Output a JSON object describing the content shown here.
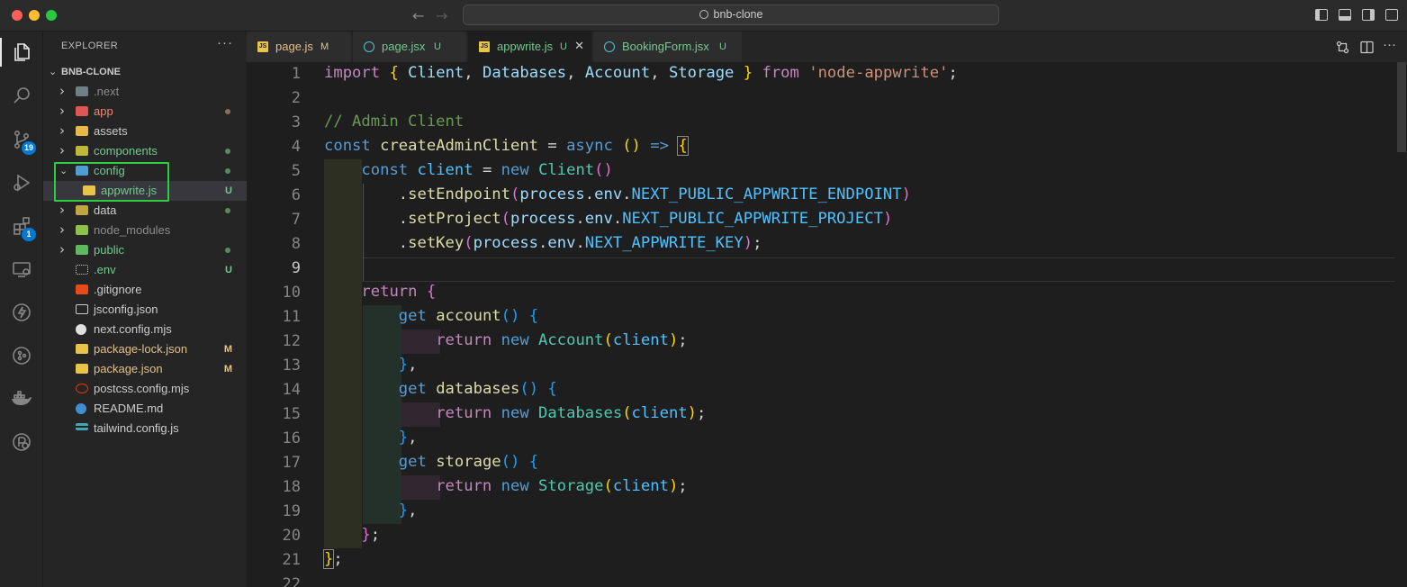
{
  "window": {
    "search_text": "bnb-clone",
    "colors": {
      "close": "#ff5f57",
      "minimize": "#febc2e",
      "maximize": "#28c840"
    }
  },
  "activity_bar": {
    "icons": [
      "explorer-icon",
      "search-icon",
      "source-control-icon",
      "run-debug-icon",
      "extensions-icon",
      "remote-explorer-icon",
      "lightning-icon",
      "git-graph-icon",
      "docker-icon",
      "accounts-icon"
    ],
    "source_control_badge": "19",
    "extensions_badge": "1"
  },
  "explorer": {
    "header": "EXPLORER",
    "more": "···",
    "project": "BNB-CLONE",
    "items": [
      {
        "label": ".next",
        "kind": "folder",
        "status": ""
      },
      {
        "label": "app",
        "kind": "folder",
        "status": "dot"
      },
      {
        "label": "assets",
        "kind": "folder",
        "status": ""
      },
      {
        "label": "components",
        "kind": "folder",
        "status": "dot"
      },
      {
        "label": "config",
        "kind": "folder-open",
        "status": "dot"
      },
      {
        "label": "appwrite.js",
        "kind": "js",
        "status": "U"
      },
      {
        "label": "data",
        "kind": "folder",
        "status": "dot"
      },
      {
        "label": "node_modules",
        "kind": "folder",
        "status": ""
      },
      {
        "label": "public",
        "kind": "folder",
        "status": "dot"
      },
      {
        "label": ".env",
        "kind": "env",
        "status": "U"
      },
      {
        "label": ".gitignore",
        "kind": "git",
        "status": ""
      },
      {
        "label": "jsconfig.json",
        "kind": "json",
        "status": ""
      },
      {
        "label": "next.config.mjs",
        "kind": "next",
        "status": ""
      },
      {
        "label": "package-lock.json",
        "kind": "npm",
        "status": "M"
      },
      {
        "label": "package.json",
        "kind": "npm",
        "status": "M"
      },
      {
        "label": "postcss.config.mjs",
        "kind": "postcss",
        "status": ""
      },
      {
        "label": "README.md",
        "kind": "info",
        "status": ""
      },
      {
        "label": "tailwind.config.js",
        "kind": "tailwind",
        "status": ""
      }
    ]
  },
  "tabs": [
    {
      "label": "page.js",
      "status": "M",
      "icon": "js"
    },
    {
      "label": "page.jsx",
      "status": "U",
      "icon": "react"
    },
    {
      "label": "appwrite.js",
      "status": "U",
      "icon": "js",
      "active": true,
      "close": "✕"
    },
    {
      "label": "BookingForm.jsx",
      "status": "U",
      "icon": "react"
    }
  ],
  "editor": {
    "line_numbers": [
      "1",
      "2",
      "3",
      "4",
      "5",
      "6",
      "7",
      "8",
      "9",
      "10",
      "11",
      "12",
      "13",
      "14",
      "15",
      "16",
      "17",
      "18",
      "19",
      "20",
      "21",
      "22"
    ],
    "current_line": "9",
    "tokens": {
      "import": "import",
      "from": "from",
      "const": "const",
      "async": "async",
      "new": "new",
      "return": "return",
      "get": "get",
      "Client": "Client",
      "Databases": "Databases",
      "Account": "Account",
      "Storage": "Storage",
      "module": "'node-appwrite'",
      "comment": "// Admin Client",
      "createAdminClient": "createAdminClient",
      "client": "client",
      "setEndpoint": "setEndpoint",
      "setProject": "setProject",
      "setKey": "setKey",
      "process": "process",
      "env": "env",
      "endpoint_var": "NEXT_PUBLIC_APPWRITE_ENDPOINT",
      "project_var": "NEXT_PUBLIC_APPWRITE_PROJECT",
      "key_var": "NEXT_APPWRITE_KEY",
      "account": "account",
      "databases": "databases",
      "storage": "storage"
    }
  }
}
